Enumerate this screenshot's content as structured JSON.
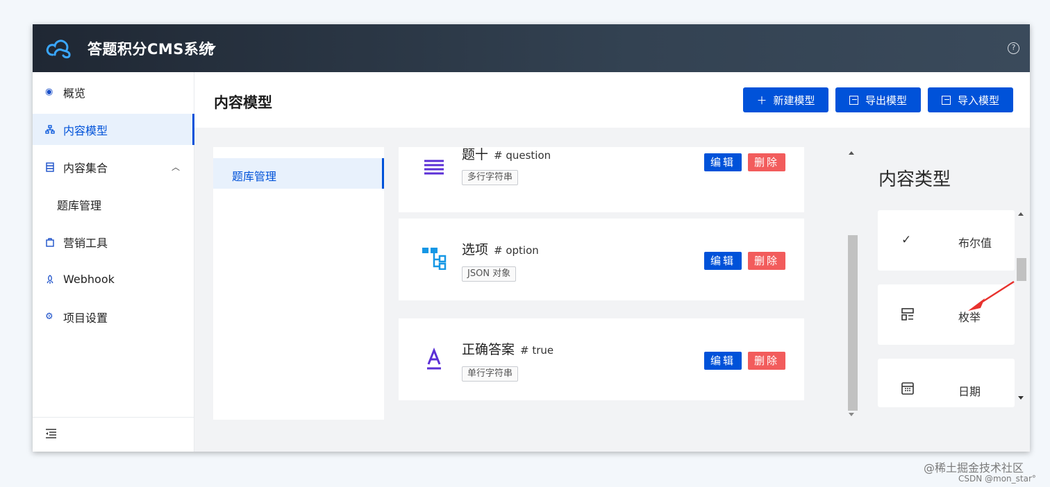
{
  "app": {
    "title": "答题积分CMS系统"
  },
  "sidebar": {
    "items": [
      {
        "label": "概览",
        "icon": "eye-icon"
      },
      {
        "label": "内容模型",
        "icon": "sitemap-icon",
        "active": true
      },
      {
        "label": "内容集合",
        "icon": "database-icon",
        "expanded": true
      },
      {
        "label": "题库管理",
        "sub": true
      },
      {
        "label": "营销工具",
        "icon": "bag-icon"
      },
      {
        "label": "Webhook",
        "icon": "webhook-icon"
      },
      {
        "label": "项目设置",
        "icon": "gear-icon"
      }
    ]
  },
  "header": {
    "title": "内容模型",
    "buttons": {
      "new": "新建模型",
      "export": "导出模型",
      "import": "导入模型"
    }
  },
  "models": [
    {
      "label": "题库管理",
      "active": true
    }
  ],
  "fields": [
    {
      "name": "题十",
      "key": "# question",
      "tag": "多行字符串",
      "icon": "multiline-text-icon"
    },
    {
      "name": "选项",
      "key": "# option",
      "tag": "JSON 对象",
      "icon": "json-icon"
    },
    {
      "name": "正确答案",
      "key": "# true",
      "tag": "单行字符串",
      "icon": "single-line-text-icon"
    }
  ],
  "field_actions": {
    "edit": "编辑",
    "delete": "删除"
  },
  "content_types": {
    "title": "内容类型",
    "items": [
      {
        "label": "布尔值",
        "icon": "check-icon"
      },
      {
        "label": "枚举",
        "icon": "enum-icon"
      },
      {
        "label": "日期",
        "icon": "calendar-icon"
      }
    ]
  },
  "watermark": {
    "line1": "@稀土掘金技术社区",
    "line2": "CSDN @mon_star°"
  },
  "colors": {
    "primary": "#0052d9",
    "danger": "#f25c5c",
    "topbar": "#2b3745",
    "accent_icon": "#5b2fd6",
    "json_icon": "#1597e5"
  }
}
